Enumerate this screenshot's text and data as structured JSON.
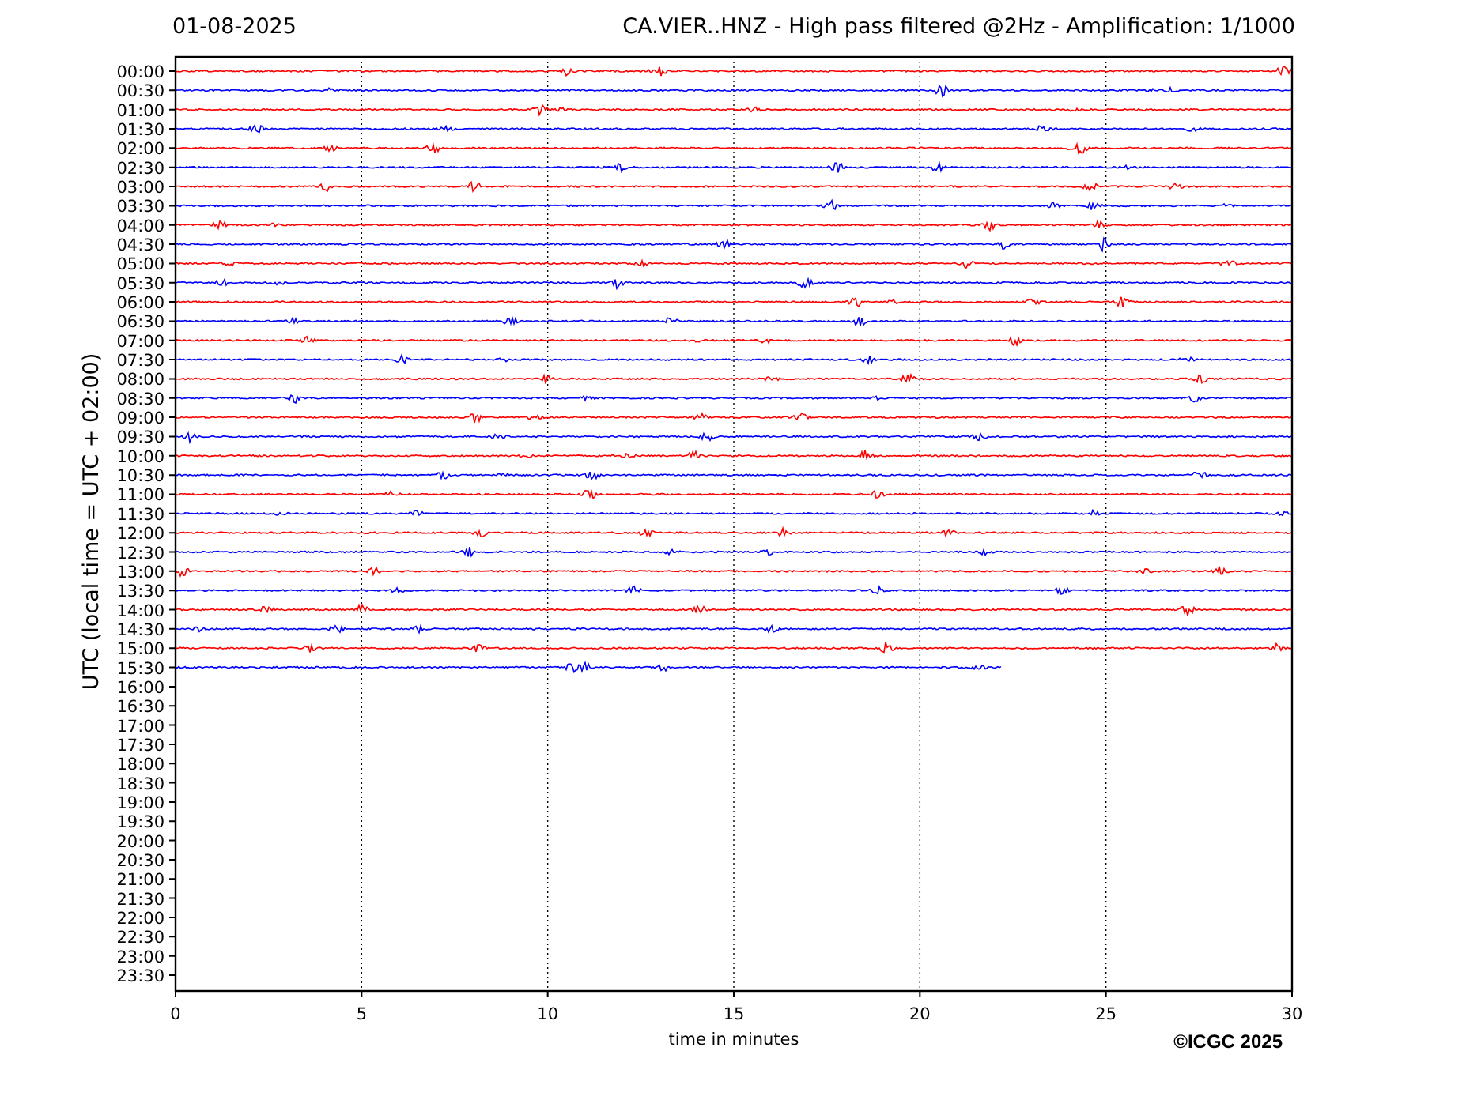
{
  "header": {
    "date": "01-08-2025",
    "title": "CA.VIER..HNZ - High pass filtered @2Hz - Amplification: 1/1000"
  },
  "plot": {
    "ylabel": "UTC (local time = UTC + 02:00)",
    "xlabel": "time in minutes",
    "xticks": [
      "0",
      "5",
      "10",
      "15",
      "20",
      "25",
      "30"
    ],
    "yticks": [
      "00:00",
      "00:30",
      "01:00",
      "01:30",
      "02:00",
      "02:30",
      "03:00",
      "03:30",
      "04:00",
      "04:30",
      "05:00",
      "05:30",
      "06:00",
      "06:30",
      "07:00",
      "07:30",
      "08:00",
      "08:30",
      "09:00",
      "09:30",
      "10:00",
      "10:30",
      "11:00",
      "11:30",
      "12:00",
      "12:30",
      "13:00",
      "13:30",
      "14:00",
      "14:30",
      "15:00",
      "15:30",
      "16:00",
      "16:30",
      "17:00",
      "17:30",
      "18:00",
      "18:30",
      "19:00",
      "19:30",
      "20:00",
      "20:30",
      "21:00",
      "21:30",
      "22:00",
      "22:30",
      "23:00",
      "23:30"
    ],
    "traces": [
      {
        "color": "#ff0000",
        "kind": "full"
      },
      {
        "color": "#0000ff",
        "kind": "full"
      },
      {
        "color": "#ff0000",
        "kind": "full"
      },
      {
        "color": "#0000ff",
        "kind": "full"
      },
      {
        "color": "#ff0000",
        "kind": "full"
      },
      {
        "color": "#0000ff",
        "kind": "full"
      },
      {
        "color": "#ff0000",
        "kind": "full"
      },
      {
        "color": "#0000ff",
        "kind": "full"
      },
      {
        "color": "#ff0000",
        "kind": "full"
      },
      {
        "color": "#0000ff",
        "kind": "full"
      },
      {
        "color": "#ff0000",
        "kind": "full"
      },
      {
        "color": "#0000ff",
        "kind": "full"
      },
      {
        "color": "#ff0000",
        "kind": "full"
      },
      {
        "color": "#0000ff",
        "kind": "full"
      },
      {
        "color": "#ff0000",
        "kind": "full"
      },
      {
        "color": "#0000ff",
        "kind": "full"
      },
      {
        "color": "#ff0000",
        "kind": "full"
      },
      {
        "color": "#0000ff",
        "kind": "full"
      },
      {
        "color": "#ff0000",
        "kind": "full"
      },
      {
        "color": "#0000ff",
        "kind": "full"
      },
      {
        "color": "#ff0000",
        "kind": "full"
      },
      {
        "color": "#0000ff",
        "kind": "full"
      },
      {
        "color": "#ff0000",
        "kind": "full"
      },
      {
        "color": "#0000ff",
        "kind": "full"
      },
      {
        "color": "#ff0000",
        "kind": "full"
      },
      {
        "color": "#0000ff",
        "kind": "full"
      },
      {
        "color": "#ff0000",
        "kind": "full"
      },
      {
        "color": "#0000ff",
        "kind": "full"
      },
      {
        "color": "#ff0000",
        "kind": "full"
      },
      {
        "color": "#0000ff",
        "kind": "full"
      },
      {
        "color": "#ff0000",
        "kind": "full"
      },
      {
        "color": "#0000ff",
        "kind": "partial"
      }
    ]
  },
  "copyright": "©ICGC 2025"
}
